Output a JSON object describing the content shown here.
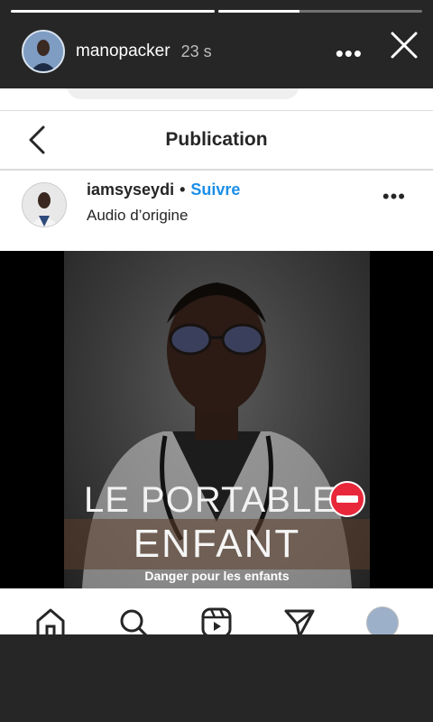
{
  "story": {
    "progress": [
      1.0,
      0.4
    ],
    "username": "manopacker",
    "time": "23 s"
  },
  "screenshot": {
    "header_title": "Publication",
    "post": {
      "username": "iamsyseydi",
      "separator": "•",
      "follow_label": "Suivre",
      "audio": "Audio d’origine"
    },
    "media": {
      "headline_line1": "LE PORTABLE",
      "headline_line2": "ENFANT",
      "subline": "Danger pour les enfants"
    },
    "nav_icons": [
      "home-icon",
      "search-icon",
      "reels-icon",
      "send-icon",
      "profile-avatar"
    ]
  }
}
